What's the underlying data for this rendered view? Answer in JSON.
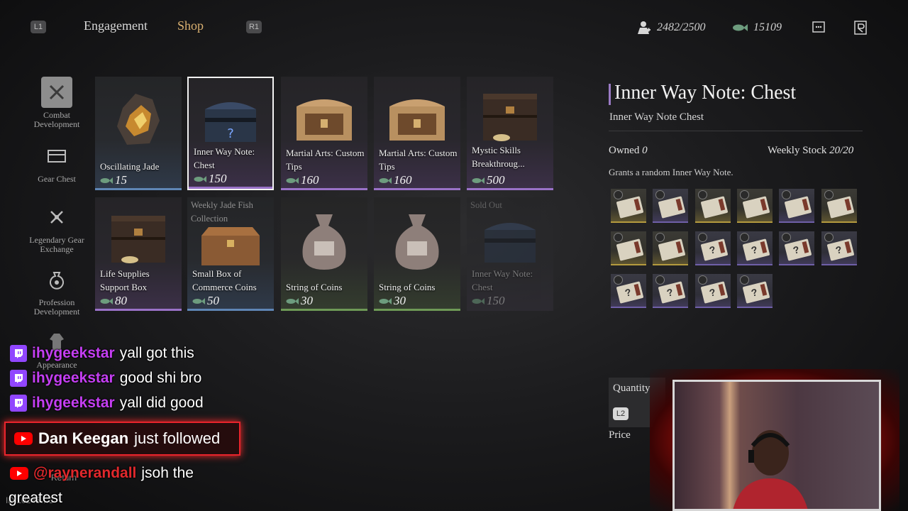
{
  "top_bar": {
    "left_button": "L1",
    "right_button": "R1",
    "tabs": [
      {
        "label": "Engagement",
        "active": false
      },
      {
        "label": "Shop",
        "active": true
      }
    ],
    "status_value": "2482/2500",
    "coins_value": "15109",
    "menu_icon": "grid-icon",
    "profile_icon": "character-icon"
  },
  "sidebar": {
    "items": [
      {
        "label": "Combat Development",
        "icon": "crossed-swords-icon",
        "selected": true
      },
      {
        "label": "Gear Chest",
        "icon": "chest-icon",
        "selected": false
      },
      {
        "label": "Legendary Gear Exchange",
        "icon": "exchange-swords-icon",
        "selected": false
      },
      {
        "label": "Profession Development",
        "icon": "money-bag-icon",
        "selected": false
      },
      {
        "label": "Appearance",
        "icon": "robe-icon",
        "selected": false
      }
    ]
  },
  "shop": {
    "items": [
      {
        "name": "Oscillating Jade",
        "price": "15",
        "rarity": "blue",
        "art": "jade-stone"
      },
      {
        "name": "Inner Way Note: Chest",
        "price": "150",
        "rarity": "purple",
        "art": "mystery-chest",
        "selected": true
      },
      {
        "name": "Martial Arts: Custom Tips",
        "price": "160",
        "rarity": "purple",
        "art": "ornate-chest"
      },
      {
        "name": "Martial Arts: Custom Tips",
        "price": "160",
        "rarity": "purple",
        "art": "ornate-chest"
      },
      {
        "name": "Mystic Skills Breakthroug...",
        "price": "500",
        "rarity": "purple",
        "art": "large-chest"
      },
      {
        "name": "Life Supplies Support Box",
        "price": "80",
        "rarity": "purple",
        "art": "large-chest"
      },
      {
        "name": "Small Box of Commerce Coins",
        "price": "50",
        "rarity": "blue",
        "art": "wood-box",
        "tag": "Weekly Jade Fish Collection"
      },
      {
        "name": "String of Coins",
        "price": "30",
        "rarity": "green",
        "art": "coin-pouch"
      },
      {
        "name": "String of Coins",
        "price": "30",
        "rarity": "green",
        "art": "coin-pouch"
      },
      {
        "name": "Inner Way Note: Chest",
        "price": "150",
        "rarity": "purple",
        "art": "mystery-chest",
        "tag": "Sold Out",
        "sold_out": true
      }
    ]
  },
  "detail": {
    "title": "Inner Way Note: Chest",
    "subtitle": "Inner Way Note Chest",
    "owned_label": "Owned",
    "owned_value": "0",
    "stock_label": "Weekly Stock",
    "stock_value": "20/20",
    "description": "Grants a random Inner Way Note.",
    "notes": [
      {
        "tier": "gold"
      },
      {
        "tier": "purple"
      },
      {
        "tier": "gold"
      },
      {
        "tier": "gold"
      },
      {
        "tier": "purple"
      },
      {
        "tier": "gold"
      },
      {
        "tier": "gold"
      },
      {
        "tier": "gold"
      },
      {
        "tier": "purple",
        "unknown": true
      },
      {
        "tier": "purple",
        "unknown": true
      },
      {
        "tier": "purple",
        "unknown": true
      },
      {
        "tier": "purple",
        "unknown": true
      },
      {
        "tier": "purple",
        "unknown": true
      },
      {
        "tier": "purple",
        "unknown": true
      },
      {
        "tier": "purple",
        "unknown": true
      },
      {
        "tier": "purple",
        "unknown": true
      }
    ],
    "quantity_label": "Quantity",
    "quantity_button": "L2",
    "price_label": "Price"
  },
  "overlay": {
    "chat": [
      {
        "platform": "twitch",
        "user": "ihygeekstar",
        "message": "yall got this"
      },
      {
        "platform": "twitch",
        "user": "ihygeekstar",
        "message": "good shi bro"
      },
      {
        "platform": "twitch",
        "user": "ihygeekstar",
        "message": "yall did good"
      }
    ],
    "follow": {
      "user": "Dan Keegan",
      "text": "just followed"
    },
    "mention": {
      "user": "@raynerandall",
      "message": "jsoh the",
      "message_cont": "greatest"
    },
    "bg_return_label": "Return",
    "bg_id_text": "ID 10245…3"
  },
  "colors": {
    "accent_gold": "#d9b070",
    "rarity_blue": "#5f86b5",
    "rarity_purple": "#9a72c8",
    "rarity_green": "#6e9a56",
    "twitch_purple": "#9146ff",
    "youtube_red": "#ff0000"
  }
}
